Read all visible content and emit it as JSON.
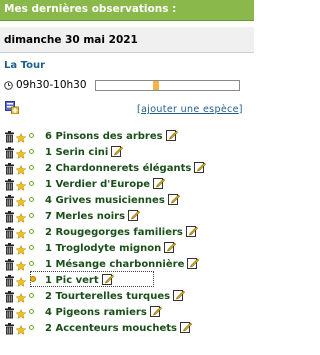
{
  "header": {
    "title": "Mes dernières observations :"
  },
  "date": "dimanche 30 mai 2021",
  "location": "La Tour",
  "time": {
    "range": "09h30-10h30",
    "timeline_fill": {
      "start": 0.4,
      "end": 0.44
    }
  },
  "add_species": {
    "open": "[",
    "label": "ajouter une espèce",
    "close": "]"
  },
  "colors": {
    "header": "#8ab84a",
    "link": "#1e5e8a",
    "species": "#1a4f1a",
    "timeline_fill": "#f3b34a"
  },
  "observations": [
    {
      "count": "6",
      "species": "Pinsons des arbres"
    },
    {
      "count": "1",
      "species": "Serin cini"
    },
    {
      "count": "2",
      "species": "Chardonnerets élégants"
    },
    {
      "count": "1",
      "species": "Verdier d'Europe"
    },
    {
      "count": "4",
      "species": "Grives musiciennes"
    },
    {
      "count": "7",
      "species": "Merles noirs"
    },
    {
      "count": "2",
      "species": "Rougegorges familiers"
    },
    {
      "count": "1",
      "species": "Troglodyte mignon"
    },
    {
      "count": "1",
      "species": "Mésange charbonnière"
    },
    {
      "count": "1",
      "species": "Pic vert"
    },
    {
      "count": "2",
      "species": "Tourterelles turques"
    },
    {
      "count": "4",
      "species": "Pigeons ramiers"
    },
    {
      "count": "2",
      "species": "Accenteurs mouchets"
    }
  ]
}
